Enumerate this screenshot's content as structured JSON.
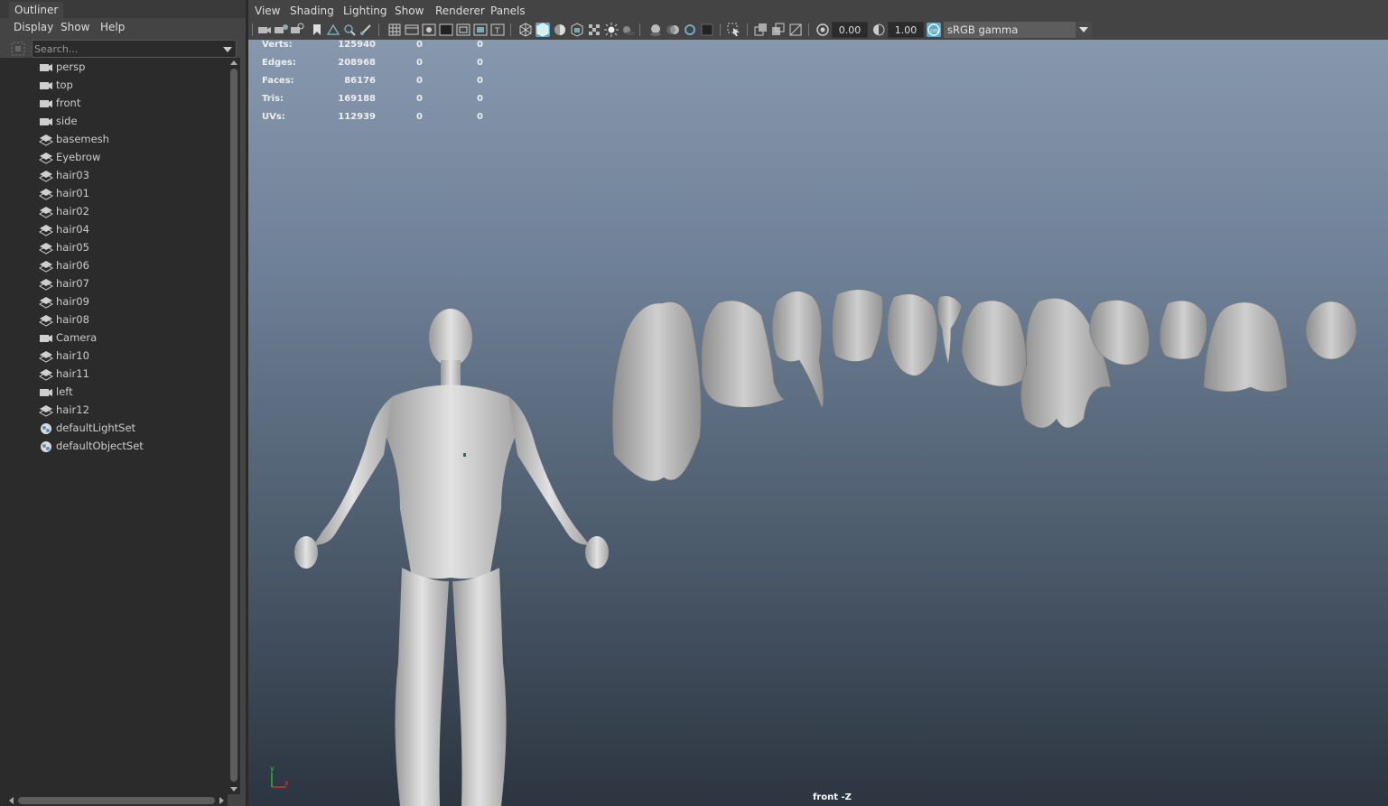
{
  "outliner": {
    "tab": "Outliner",
    "menu": [
      "Display",
      "Show",
      "Help"
    ],
    "search_placeholder": "Search...",
    "items": [
      {
        "label": "persp",
        "icon": "camera-icon"
      },
      {
        "label": "top",
        "icon": "camera-icon"
      },
      {
        "label": "front",
        "icon": "camera-icon"
      },
      {
        "label": "side",
        "icon": "camera-icon"
      },
      {
        "label": "basemesh",
        "icon": "mesh-icon"
      },
      {
        "label": "Eyebrow",
        "icon": "mesh-icon"
      },
      {
        "label": "hair03",
        "icon": "mesh-icon"
      },
      {
        "label": "hair01",
        "icon": "mesh-icon"
      },
      {
        "label": "hair02",
        "icon": "mesh-icon"
      },
      {
        "label": "hair04",
        "icon": "mesh-icon"
      },
      {
        "label": "hair05",
        "icon": "mesh-icon"
      },
      {
        "label": "hair06",
        "icon": "mesh-icon"
      },
      {
        "label": "hair07",
        "icon": "mesh-icon"
      },
      {
        "label": "hair09",
        "icon": "mesh-icon"
      },
      {
        "label": "hair08",
        "icon": "mesh-icon"
      },
      {
        "label": "Camera",
        "icon": "camera-icon"
      },
      {
        "label": "hair10",
        "icon": "mesh-icon"
      },
      {
        "label": "hair11",
        "icon": "mesh-icon"
      },
      {
        "label": "left",
        "icon": "camera-icon"
      },
      {
        "label": "hair12",
        "icon": "mesh-icon"
      },
      {
        "label": "defaultLightSet",
        "icon": "set-icon"
      },
      {
        "label": "defaultObjectSet",
        "icon": "set-icon"
      }
    ]
  },
  "panel": {
    "menu": [
      "View",
      "Shading",
      "Lighting",
      "Show",
      "Renderer",
      "Panels"
    ],
    "exposure": "0.00",
    "gamma": "1.00",
    "color_space": "sRGB gamma",
    "accent_color": "#5fa7c9"
  },
  "hud": {
    "stats": [
      {
        "label": "Verts:",
        "value": "125940",
        "a": "0",
        "b": "0"
      },
      {
        "label": "Edges:",
        "value": "208968",
        "a": "0",
        "b": "0"
      },
      {
        "label": "Faces:",
        "value": "86176",
        "a": "0",
        "b": "0"
      },
      {
        "label": "Tris:",
        "value": "169188",
        "a": "0",
        "b": "0"
      },
      {
        "label": "UVs:",
        "value": "112939",
        "a": "0",
        "b": "0"
      }
    ],
    "camera": "front -Z",
    "axis_y": "y",
    "axis_x": "x"
  }
}
